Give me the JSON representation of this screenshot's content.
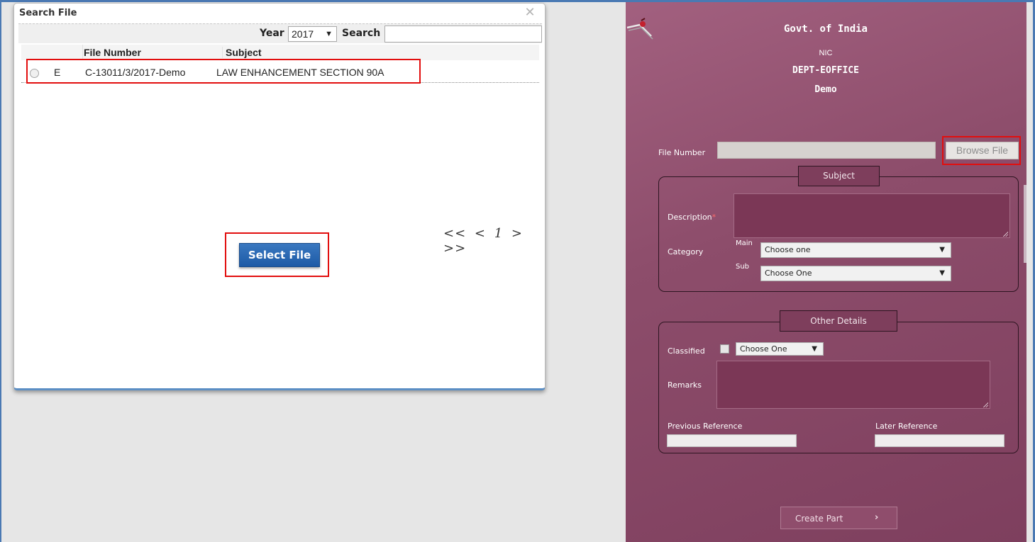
{
  "dialog": {
    "title": "Search File",
    "close_glyph": "✕",
    "year_label": "Year",
    "year_value": "2017",
    "search_label": "Search",
    "search_value": "",
    "columns": {
      "file_number": "File Number",
      "subject": "Subject"
    },
    "rows": [
      {
        "type": "E",
        "file_number": "C-13011/3/2017-Demo",
        "subject": "LAW ENHANCEMENT SECTION 90A"
      }
    ],
    "pager": {
      "first": "<<",
      "prev": "<",
      "current": "1",
      "next": ">",
      "last": ">>"
    },
    "select_button": "Select File",
    "highlight_color": "#e20e0e",
    "button_color": "#1d5aa6"
  },
  "panel": {
    "header": {
      "org": "Govt. of India",
      "nic": "NIC",
      "dept": "DEPT-EOFFICE",
      "unit": "Demo"
    },
    "file_number_label": "File Number",
    "file_number_value": "",
    "browse_button": "Browse File",
    "subject_legend": "Subject",
    "description_label": "Description",
    "required_mark": "*",
    "category_label": "Category",
    "main_label": "Main",
    "main_value": "Choose one",
    "sub_label": "Sub",
    "sub_value": "Choose One",
    "other_legend": "Other Details",
    "classified_label": "Classified",
    "classified_value": "Choose One",
    "remarks_label": "Remarks",
    "previous_reference_label": "Previous Reference",
    "later_reference_label": "Later Reference",
    "create_button": "Create Part",
    "create_arrow": "›",
    "background_color": "#8d4d6b",
    "logo_icon": "pen-logo-icon"
  }
}
